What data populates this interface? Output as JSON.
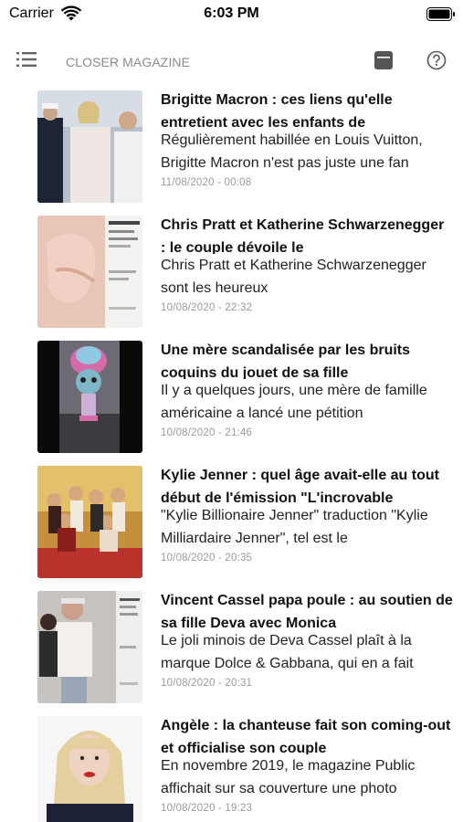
{
  "status_bar": {
    "carrier": "Carrier",
    "time": "6:03 PM"
  },
  "nav": {
    "title": "CLOSER MAGAZINE",
    "menu_icon": "list-icon",
    "reader_icon": "book-icon",
    "help_icon": "help-icon"
  },
  "articles": [
    {
      "title": "Brigitte Macron : ces liens qu'elle entretient avec les enfants de",
      "summary": "Régulièrement habillée en Louis Vuitton, Brigitte Macron n'est pas juste une fan",
      "date": "11/08/2020 - 00:08"
    },
    {
      "title": "Chris Pratt et Katherine Schwarzenegger : le couple dévoile le",
      "summary": "Chris Pratt et Katherine Schwarzenegger sont les heureux",
      "date": "10/08/2020 - 22:32"
    },
    {
      "title": "Une mère scandalisée par les bruits coquins du jouet de sa fille",
      "summary": "Il y a quelques jours, une mère de famille américaine a lancé une pétition",
      "date": "10/08/2020 - 21:46"
    },
    {
      "title": "Kylie Jenner : quel âge avait-elle au tout début de l'émission \"L'incrovable",
      "summary": "\"Kylie Billionaire Jenner\" traduction \"Kylie Milliardaire Jenner\", tel est le",
      "date": "10/08/2020 - 20:35"
    },
    {
      "title": "Vincent Cassel papa poule : au soutien de sa fille Deva avec Monica",
      "summary": "Le joli minois de Deva Cassel plaît à la marque Dolce & Gabbana, qui en a fait",
      "date": "10/08/2020 - 20:31"
    },
    {
      "title": "Angèle : la chanteuse fait son coming-out et officialise son couple",
      "summary": "En novembre 2019, le magazine Public affichait sur sa couverture une photo",
      "date": "10/08/2020 - 19:23"
    }
  ]
}
